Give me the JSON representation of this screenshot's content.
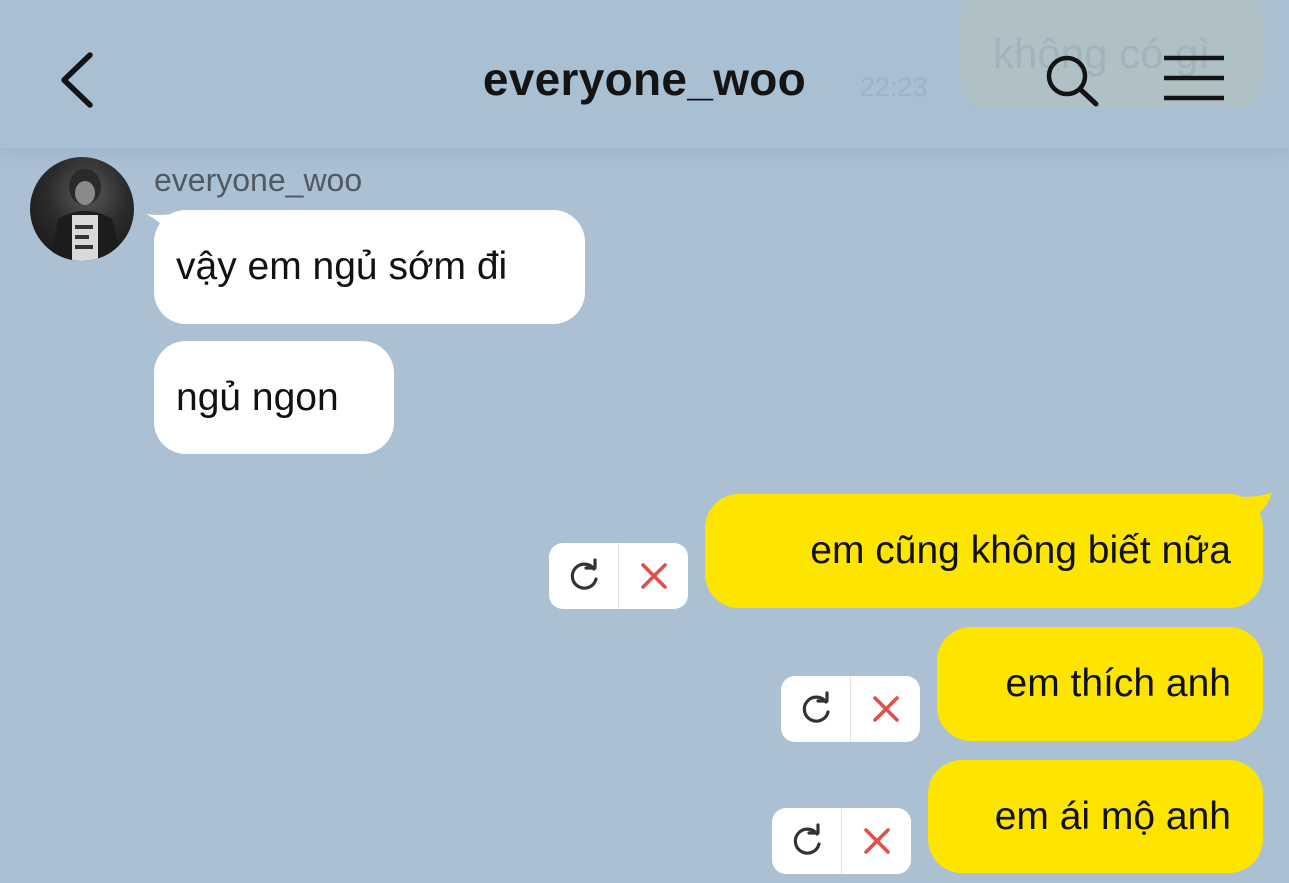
{
  "header": {
    "title": "everyone_woo",
    "back_icon": "chevron-left-icon",
    "search_icon": "search-icon",
    "menu_icon": "hamburger-menu-icon",
    "ghost_message": "không có gì",
    "ghost_time": "22:23"
  },
  "conversation": {
    "sender_name": "everyone_woo",
    "incoming": [
      {
        "text": "vậy em ngủ sớm đi"
      },
      {
        "text": "ngủ ngon"
      }
    ],
    "outgoing": [
      {
        "text": "em cũng không biết nữa",
        "status": "failed"
      },
      {
        "text": "em thích anh",
        "status": "failed"
      },
      {
        "text": "em ái mộ anh",
        "status": "failed"
      }
    ],
    "retry_icon": "retry-icon",
    "delete_icon": "close-icon"
  },
  "colors": {
    "background": "#abc1d3",
    "outgoing_bubble": "#fee500",
    "incoming_bubble": "#ffffff",
    "delete_icon": "#e0504a"
  }
}
